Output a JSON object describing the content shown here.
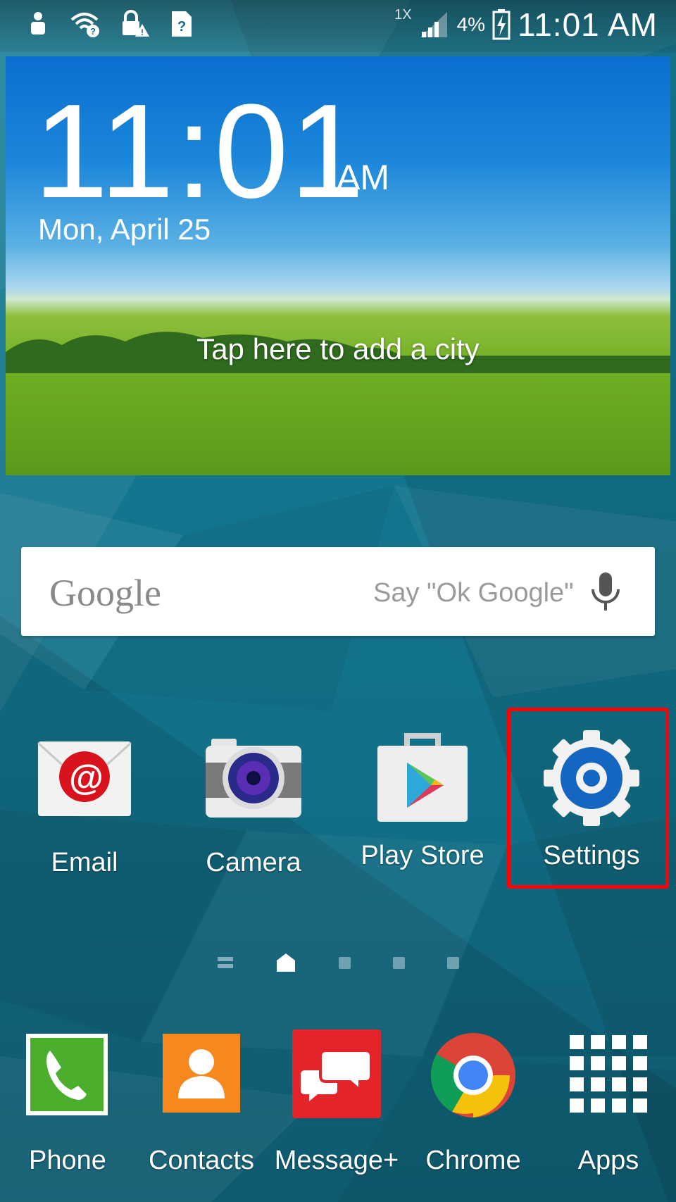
{
  "status_bar": {
    "time": "11:01 AM",
    "battery": "4%",
    "network": "1X",
    "icons": [
      "person-icon",
      "wifi-help-icon",
      "lock-warning-icon",
      "sim-help-icon",
      "signal-icon",
      "battery-charging-icon"
    ]
  },
  "widget": {
    "time": "11:01",
    "ampm": "AM",
    "date": "Mon, April 25",
    "city_prompt": "Tap here to add a city"
  },
  "search": {
    "logo": "Google",
    "hint": "Say \"Ok Google\""
  },
  "apps": [
    {
      "label": "Email",
      "icon": "email-icon"
    },
    {
      "label": "Camera",
      "icon": "camera-icon"
    },
    {
      "label": "Play Store",
      "icon": "play-store-icon"
    },
    {
      "label": "Settings",
      "icon": "settings-gear-icon"
    }
  ],
  "pager": {
    "pages": 5,
    "current": 1
  },
  "dock": [
    {
      "label": "Phone",
      "icon": "phone-icon"
    },
    {
      "label": "Contacts",
      "icon": "contacts-icon"
    },
    {
      "label": "Message+",
      "icon": "message-icon"
    },
    {
      "label": "Chrome",
      "icon": "chrome-icon"
    },
    {
      "label": "Apps",
      "icon": "apps-grid-icon"
    }
  ],
  "colors": {
    "highlight": "#ff0000",
    "email_red": "#d8131d",
    "contacts_orange": "#f7881e",
    "message_red": "#e3242b",
    "phone_green": "#4cae2d",
    "settings_blue": "#1566c0"
  }
}
